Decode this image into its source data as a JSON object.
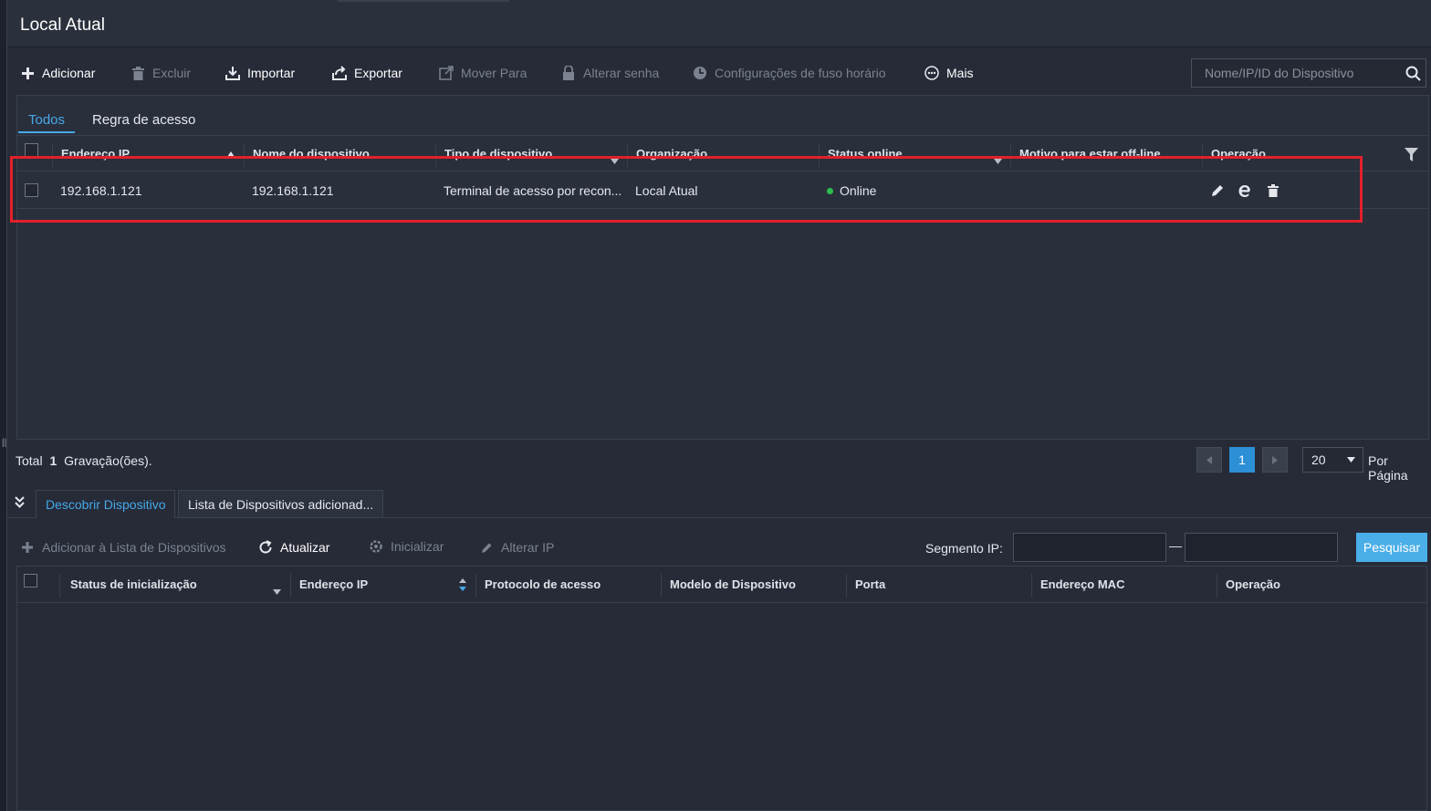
{
  "header": {
    "title": "Local Atual"
  },
  "toolbar": {
    "add": "Adicionar",
    "delete": "Excluir",
    "import": "Importar",
    "export": "Exportar",
    "move": "Mover Para",
    "change_password": "Alterar senha",
    "timezone": "Configurações de fuso horário",
    "more": "Mais"
  },
  "search": {
    "placeholder": "Nome/IP/ID do Dispositivo"
  },
  "tabs": [
    "Todos",
    "Regra de acesso"
  ],
  "device_table": {
    "columns": [
      "Endereço IP",
      "Nome do dispositivo",
      "Tipo de dispositivo",
      "Organização",
      "Status online",
      "Motivo para estar off-line",
      "Operação"
    ],
    "rows": [
      {
        "ip": "192.168.1.121",
        "name": "192.168.1.121",
        "type": "Terminal de acesso por recon...",
        "organization": "Local Atual",
        "status": "Online",
        "reason": ""
      }
    ]
  },
  "pagination": {
    "total_prefix": "Total",
    "total_count": "1",
    "total_suffix": "Gravação(ões).",
    "current_page": "1",
    "per_page": "20",
    "per_page_label": "Por Página"
  },
  "bottom_tabs": [
    "Descobrir Dispositivo",
    "Lista de Dispositivos adicionad..."
  ],
  "discovery_toolbar": {
    "add_to_list": "Adicionar à Lista de Dispositivos",
    "refresh": "Atualizar",
    "initialize": "Inicializar",
    "change_ip": "Alterar IP",
    "segment_label": "Segmento IP:",
    "search_button": "Pesquisar"
  },
  "discovery_table": {
    "columns": [
      "Status de inicialização",
      "Endereço IP",
      "Protocolo de acesso",
      "Modelo de Dispositivo",
      "Porta",
      "Endereço MAC",
      "Operação"
    ]
  },
  "colors": {
    "accent": "#45a8e8",
    "online": "#2dbd4e",
    "highlight": "#e3202a",
    "background": "#272b38"
  }
}
